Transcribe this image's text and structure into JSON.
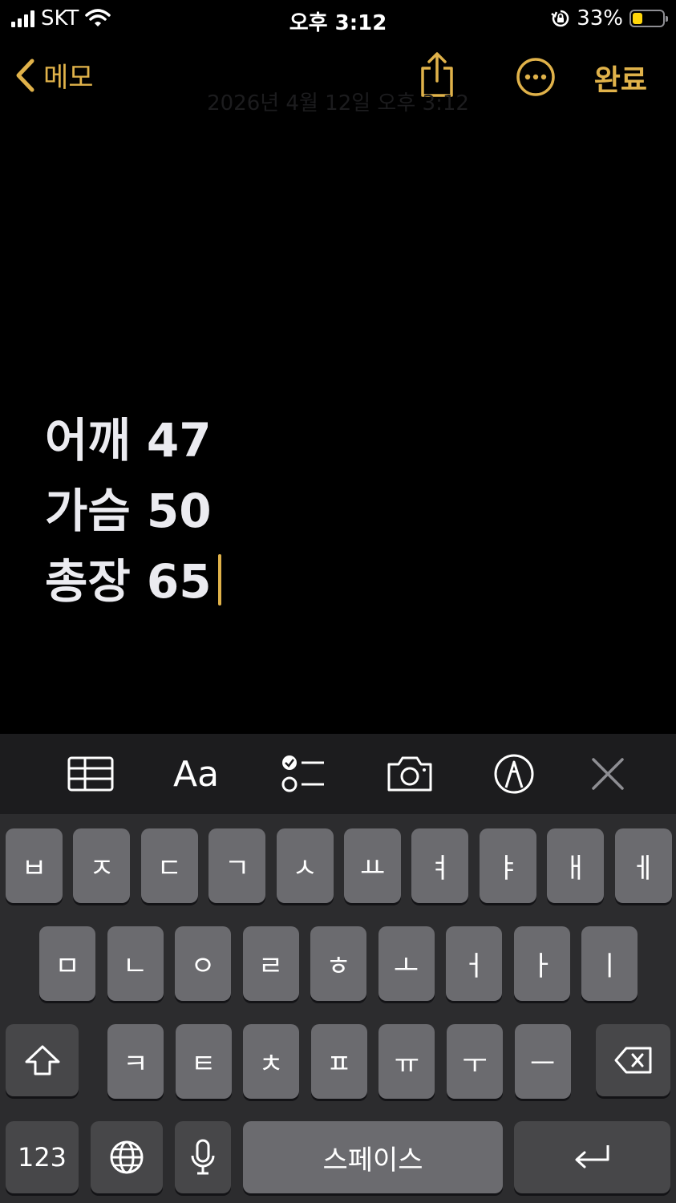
{
  "status_bar": {
    "carrier": "SKT",
    "time": "오후 3:12",
    "battery_percent": "33%",
    "battery_level": 0.33,
    "battery_color": "#ffd60a"
  },
  "nav": {
    "back_label": "메모",
    "done_label": "완료",
    "date_text": "2026년 4월 12일 오후 3:12",
    "accent_color": "#e0b24a"
  },
  "note": {
    "lines": [
      "어깨 47",
      "가슴 50",
      "총장 65"
    ]
  },
  "toolbar": {
    "text_format_label": "Aa",
    "icons": [
      "table-icon",
      "text-format-icon",
      "checklist-icon",
      "camera-icon",
      "markup-icon",
      "close-icon"
    ]
  },
  "keyboard": {
    "row1": [
      "ㅂ",
      "ㅈ",
      "ㄷ",
      "ㄱ",
      "ㅅ",
      "ㅛ",
      "ㅕ",
      "ㅑ",
      "ㅐ",
      "ㅔ"
    ],
    "row2": [
      "ㅁ",
      "ㄴ",
      "ㅇ",
      "ㄹ",
      "ㅎ",
      "ㅗ",
      "ㅓ",
      "ㅏ",
      "ㅣ"
    ],
    "row3": [
      "ㅋ",
      "ㅌ",
      "ㅊ",
      "ㅍ",
      "ㅠ",
      "ㅜ",
      "ㅡ"
    ],
    "numbers_label": "123",
    "space_label": "스페이스"
  }
}
